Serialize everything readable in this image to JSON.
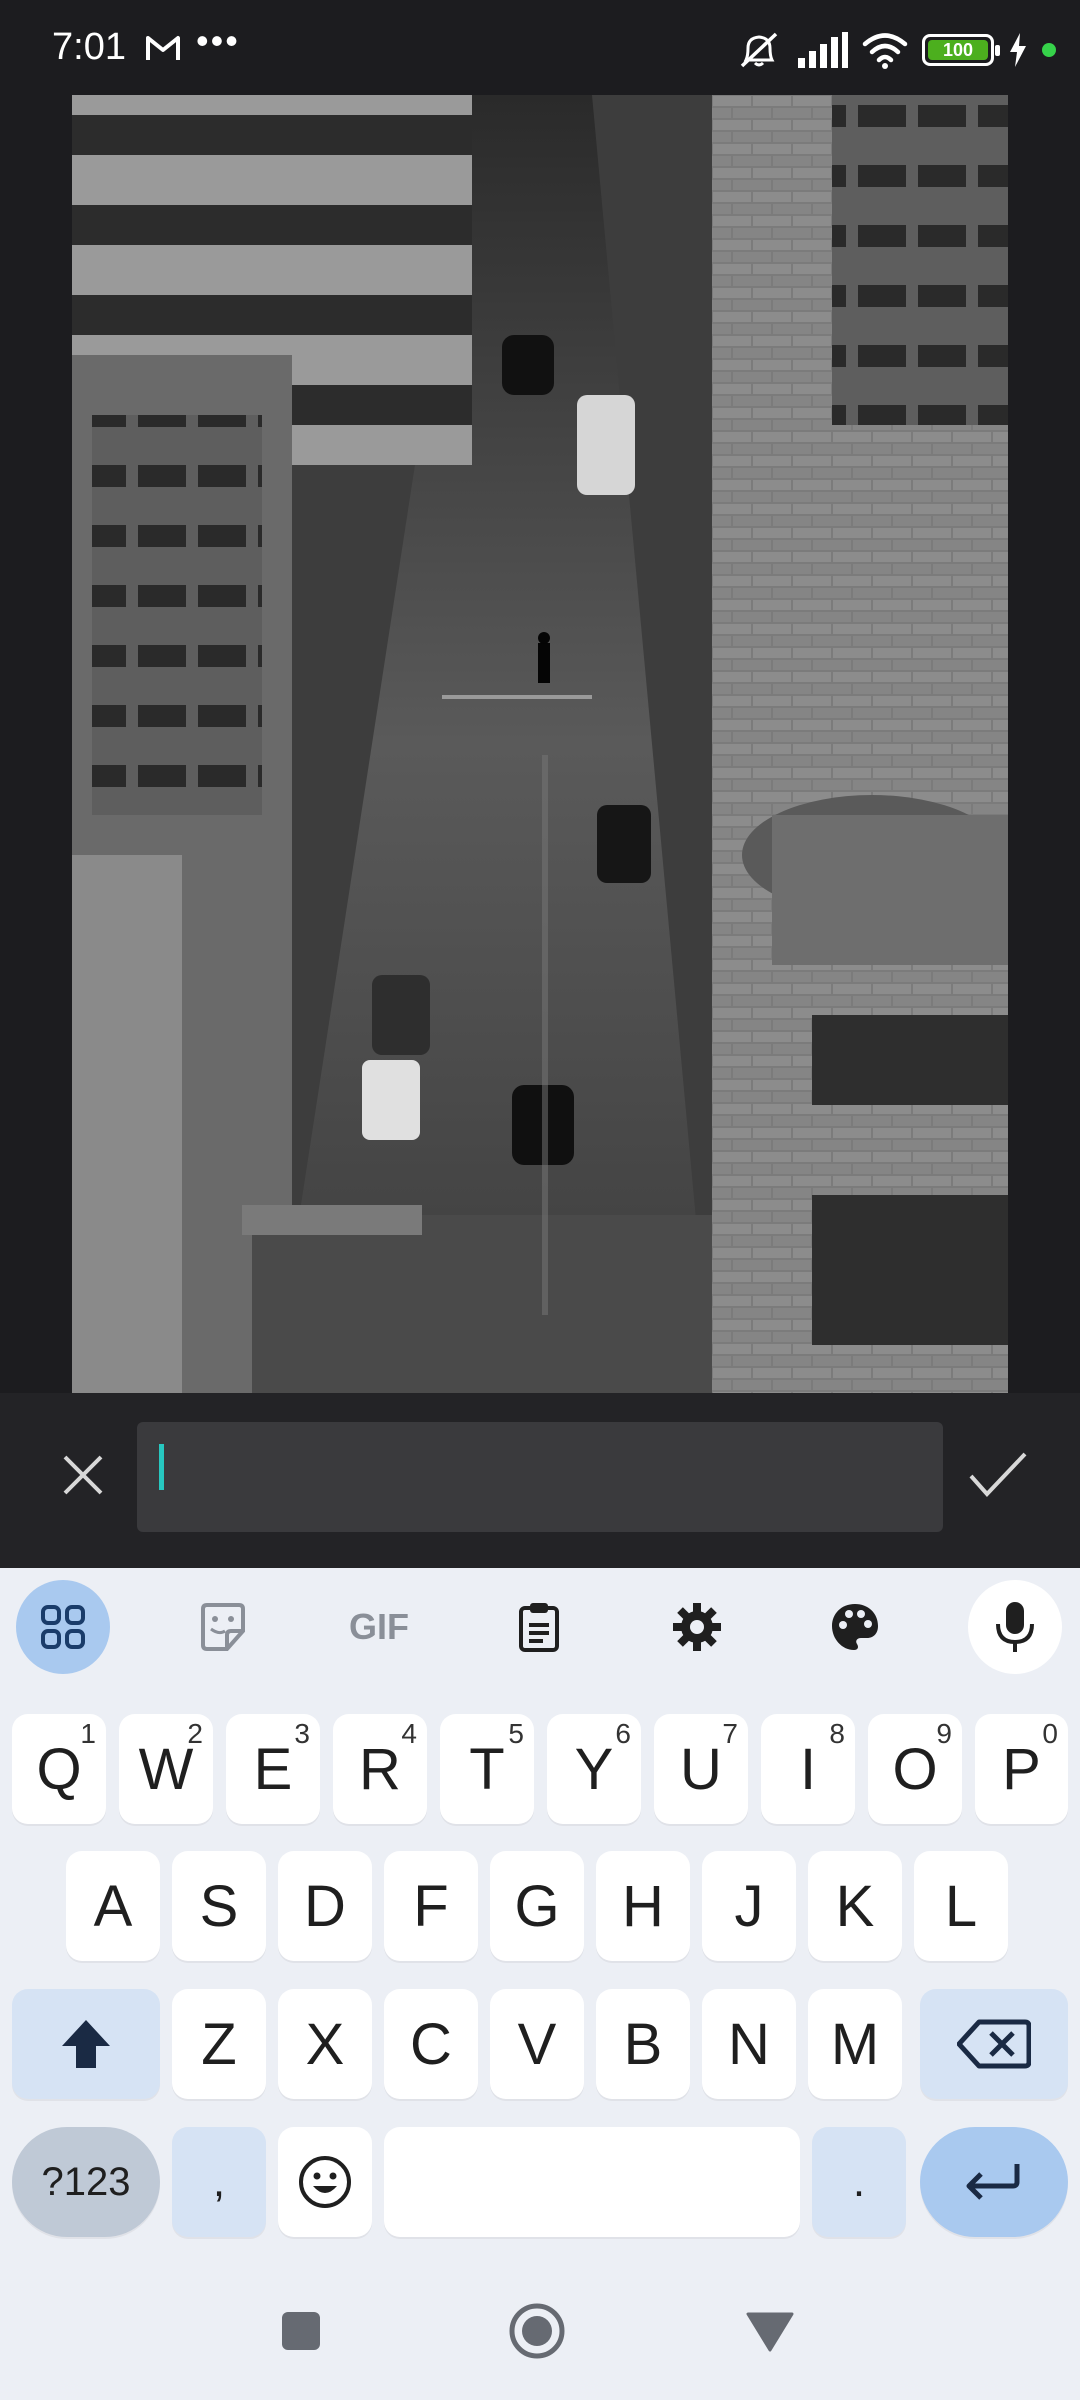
{
  "status_bar": {
    "time": "7:01",
    "battery_level": "100",
    "icons": [
      "gmail-icon",
      "more-icon",
      "mute-icon",
      "signal-icon",
      "wifi-icon",
      "battery-icon",
      "charging-icon"
    ]
  },
  "caption": {
    "input_value": "",
    "close_icon": "close-icon",
    "confirm_icon": "check-icon"
  },
  "keyboard": {
    "toolbar": {
      "apps": "apps-icon",
      "sticker": "sticker-icon",
      "gif": "GIF",
      "clipboard": "clipboard-icon",
      "settings": "gear-icon",
      "theme": "palette-icon",
      "voice": "mic-icon"
    },
    "row1": [
      {
        "key": "Q",
        "hint": "1"
      },
      {
        "key": "W",
        "hint": "2"
      },
      {
        "key": "E",
        "hint": "3"
      },
      {
        "key": "R",
        "hint": "4"
      },
      {
        "key": "T",
        "hint": "5"
      },
      {
        "key": "Y",
        "hint": "6"
      },
      {
        "key": "U",
        "hint": "7"
      },
      {
        "key": "I",
        "hint": "8"
      },
      {
        "key": "O",
        "hint": "9"
      },
      {
        "key": "P",
        "hint": "0"
      }
    ],
    "row2": [
      "A",
      "S",
      "D",
      "F",
      "G",
      "H",
      "J",
      "K",
      "L"
    ],
    "row3": [
      "Z",
      "X",
      "C",
      "V",
      "B",
      "N",
      "M"
    ],
    "row4": {
      "symbols": "?123",
      "comma": ",",
      "emoji": "emoji-icon",
      "space": "",
      "period": ".",
      "enter": "enter-icon"
    }
  },
  "navigation": {
    "recents": "square-icon",
    "home": "home-circle-icon",
    "back": "back-triangle-icon"
  },
  "colors": {
    "background": "#1c1c1f",
    "caret": "#27c7c0",
    "keyboard_bg": "#eceff5",
    "accent_key": "#a9c9ef",
    "battery": "#4caf1e"
  }
}
